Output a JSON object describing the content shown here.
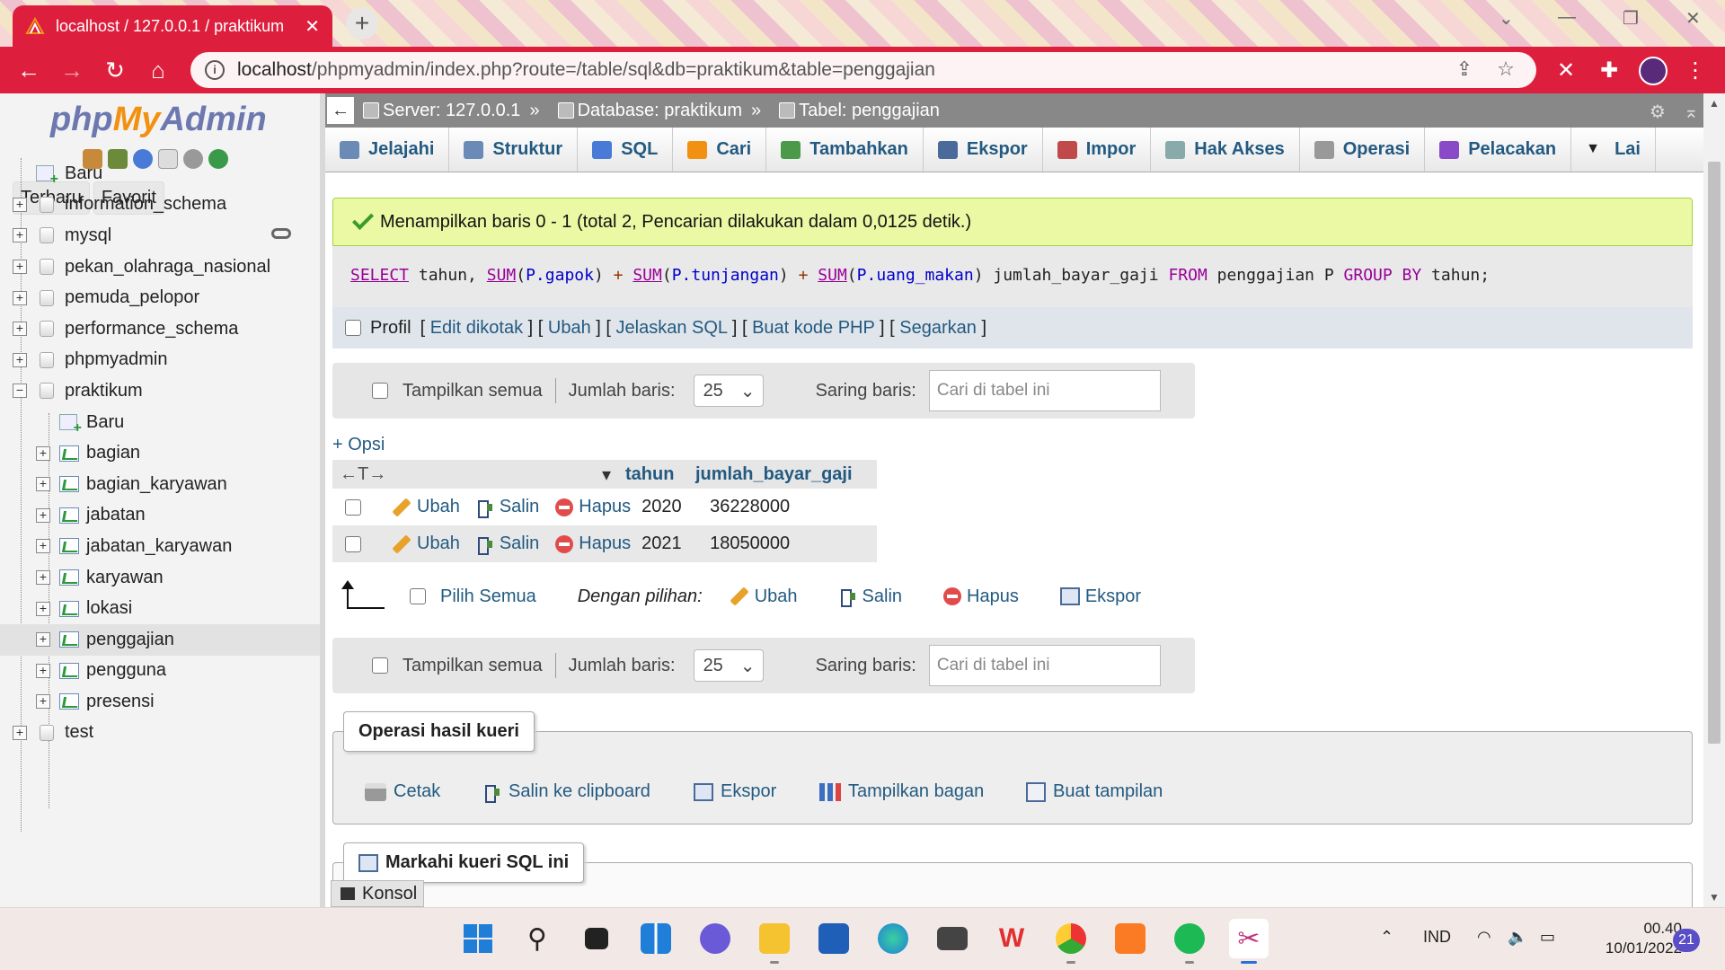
{
  "browser": {
    "tab_title": "localhost / 127.0.0.1 / praktikum",
    "url_host": "localhost",
    "url_path": "/phpmyadmin/index.php?route=/table/sql&db=praktikum&table=penggajian"
  },
  "sidebar": {
    "logo_php": "php",
    "logo_my": "My",
    "logo_admin": "Admin",
    "tab_recent": "Terbaru",
    "tab_favorite": "Favorit",
    "tree": [
      {
        "label": "Baru",
        "level": 0,
        "kind": "new"
      },
      {
        "label": "information_schema",
        "level": 0,
        "kind": "db"
      },
      {
        "label": "mysql",
        "level": 0,
        "kind": "db"
      },
      {
        "label": "pekan_olahraga_nasional",
        "level": 0,
        "kind": "db"
      },
      {
        "label": "pemuda_pelopor",
        "level": 0,
        "kind": "db"
      },
      {
        "label": "performance_schema",
        "level": 0,
        "kind": "db"
      },
      {
        "label": "phpmyadmin",
        "level": 0,
        "kind": "db"
      },
      {
        "label": "praktikum",
        "level": 0,
        "kind": "db-open"
      },
      {
        "label": "Baru",
        "level": 1,
        "kind": "new"
      },
      {
        "label": "bagian",
        "level": 1,
        "kind": "table"
      },
      {
        "label": "bagian_karyawan",
        "level": 1,
        "kind": "table"
      },
      {
        "label": "jabatan",
        "level": 1,
        "kind": "table"
      },
      {
        "label": "jabatan_karyawan",
        "level": 1,
        "kind": "table"
      },
      {
        "label": "karyawan",
        "level": 1,
        "kind": "table"
      },
      {
        "label": "lokasi",
        "level": 1,
        "kind": "table"
      },
      {
        "label": "penggajian",
        "level": 1,
        "kind": "table",
        "active": true
      },
      {
        "label": "pengguna",
        "level": 1,
        "kind": "table"
      },
      {
        "label": "presensi",
        "level": 1,
        "kind": "table"
      },
      {
        "label": "test",
        "level": 0,
        "kind": "db"
      }
    ]
  },
  "breadcrumb": {
    "server": "Server: 127.0.0.1",
    "database": "Database: praktikum",
    "table": "Tabel: penggajian",
    "sep": "»"
  },
  "menu": [
    "Jelajahi",
    "Struktur",
    "SQL",
    "Cari",
    "Tambahkan",
    "Ekspor",
    "Impor",
    "Hak Akses",
    "Operasi",
    "Pelacakan",
    "Lai"
  ],
  "message": "Menampilkan baris 0 - 1 (total 2, Pencarian dilakukan dalam 0,0125 detik.)",
  "sql_tools": {
    "profile": "Profil",
    "links": [
      "Edit dikotak",
      "Ubah",
      "Jelaskan SQL",
      "Buat kode PHP",
      "Segarkan"
    ]
  },
  "nav": {
    "show_all": "Tampilkan semua",
    "row_count_label": "Jumlah baris:",
    "row_count": "25",
    "filter_label": "Saring baris:",
    "filter_placeholder": "Cari di tabel ini"
  },
  "options_link": "+ Opsi",
  "results": {
    "columns": [
      "tahun",
      "jumlah_bayar_gaji"
    ],
    "edit": "Ubah",
    "copy": "Salin",
    "delete": "Hapus",
    "rows": [
      {
        "tahun": "2020",
        "jumlah_bayar_gaji": "36228000"
      },
      {
        "tahun": "2021",
        "jumlah_bayar_gaji": "18050000"
      }
    ]
  },
  "bulk": {
    "select_all": "Pilih Semua",
    "with_selected": "Dengan pilihan:",
    "edit": "Ubah",
    "copy": "Salin",
    "delete": "Hapus",
    "export": "Ekspor"
  },
  "query_ops": {
    "legend": "Operasi hasil kueri",
    "print": "Cetak",
    "clipboard": "Salin ke clipboard",
    "export": "Ekspor",
    "chart": "Tampilkan bagan",
    "view": "Buat tampilan"
  },
  "bookmark_legend": "Markahi kueri SQL ini",
  "console": "Konsol",
  "taskbar": {
    "lang": "IND",
    "time": "00.40",
    "date": "10/01/2022",
    "notifications": "21"
  },
  "colors": {
    "chrome_red": "#dd1f3d",
    "success_bg": "#ebf8a4",
    "link_blue": "#235a81"
  }
}
